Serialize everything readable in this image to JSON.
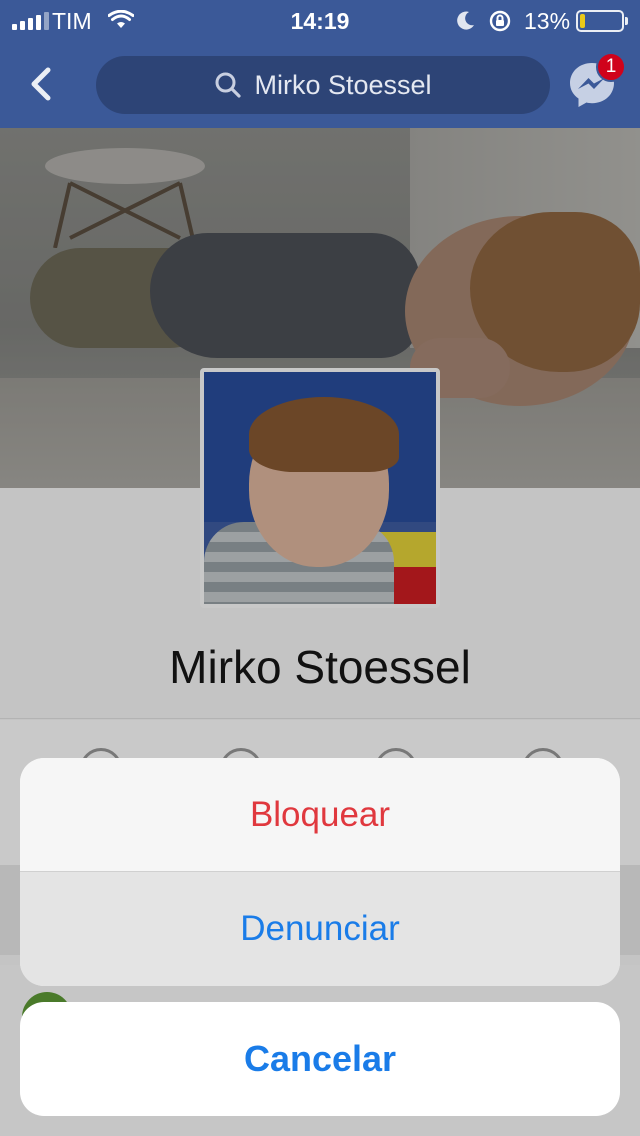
{
  "status_bar": {
    "carrier": "TIM",
    "time": "14:19",
    "battery_percent_label": "13%",
    "battery_level": 0.13,
    "battery_color": "#ffd60a"
  },
  "navbar": {
    "search_text": "Mirko Stoessel",
    "messenger_badge": "1",
    "back_icon": "chevron-left-icon",
    "search_icon": "search-icon",
    "messenger_icon": "messenger-icon"
  },
  "profile": {
    "name": "Mirko Stoessel"
  },
  "action_sheet": {
    "items": [
      {
        "label": "Bloquear",
        "style": "destructive",
        "color": "#e0383e"
      },
      {
        "label": "Denunciar",
        "style": "default",
        "color": "#1a7ce8"
      }
    ],
    "cancel_label": "Cancelar"
  },
  "colors": {
    "brand": "#3b5998",
    "ios_blue": "#1a7ce8",
    "destructive_red": "#e0383e"
  }
}
